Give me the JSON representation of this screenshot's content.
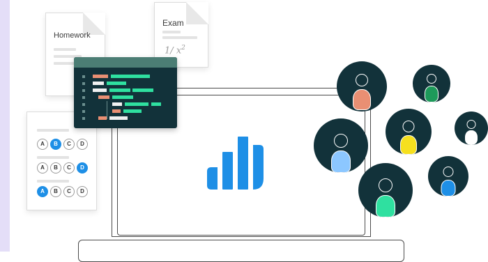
{
  "homework": {
    "title": "Homework"
  },
  "exam": {
    "title": "Exam",
    "formula_numerator": "1",
    "formula_slash": "/",
    "formula_base": "x",
    "formula_exp": "2"
  },
  "quiz": {
    "rows": [
      {
        "options": [
          "A",
          "B",
          "C",
          "D"
        ],
        "selected": "B"
      },
      {
        "options": [
          "A",
          "B",
          "C",
          "D"
        ],
        "selected": "D"
      },
      {
        "options": [
          "A",
          "B",
          "C",
          "D"
        ],
        "selected": "A"
      }
    ]
  },
  "colors": {
    "accent_blue": "#1e8fe6",
    "dark_teal": "#12323a",
    "code_header": "#4b7d74",
    "code_green": "#2fe0a0",
    "code_salmon": "#e98f73",
    "code_white": "#f1f1f1",
    "strip": "#e4def8"
  },
  "avatars": [
    {
      "name": "avatar-salmon",
      "body_color": "#e98f73"
    },
    {
      "name": "avatar-green",
      "body_color": "#1d9a5a"
    },
    {
      "name": "avatar-light-blue",
      "body_color": "#8cc7ff"
    },
    {
      "name": "avatar-yellow",
      "body_color": "#f6e01e"
    },
    {
      "name": "avatar-white",
      "body_color": "#ffffff"
    },
    {
      "name": "avatar-blue",
      "body_color": "#1e8fe6"
    },
    {
      "name": "avatar-mint",
      "body_color": "#2fe0a0"
    }
  ],
  "logo": {
    "icon": "bar-chart-logo-icon"
  }
}
